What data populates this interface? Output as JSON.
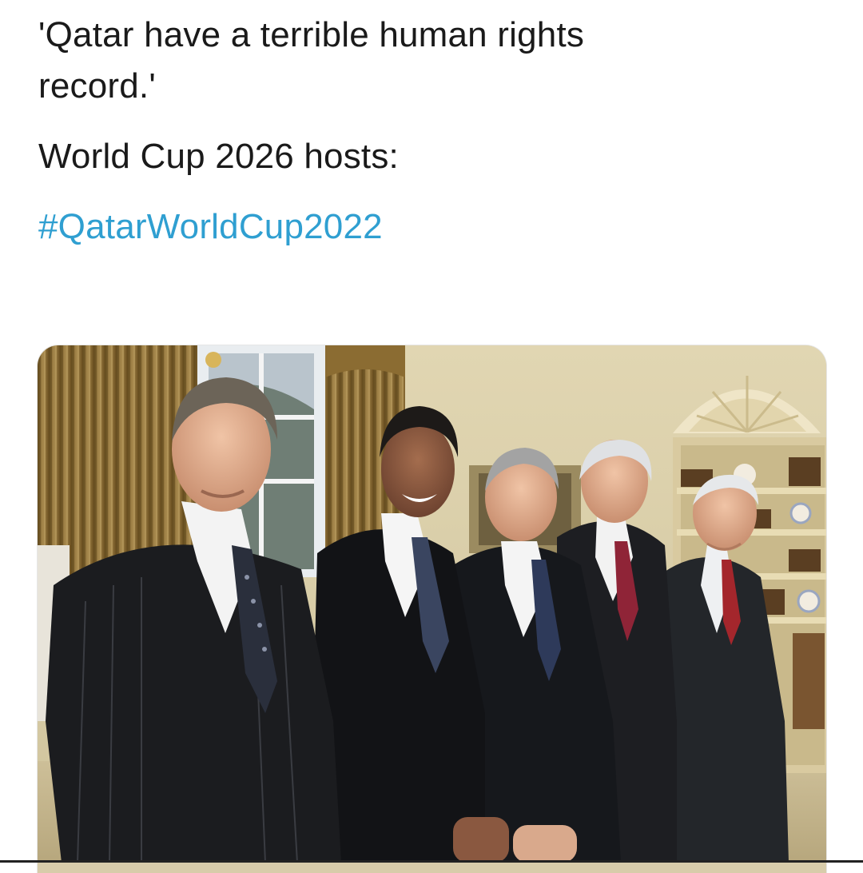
{
  "tweet": {
    "lines": [
      "'Qatar have a terrible human rights",
      "record.'",
      "World Cup 2026 hosts:"
    ],
    "hashtag": "#QatarWorldCup2022"
  },
  "media": {
    "kind": "photo",
    "people_count": 5
  },
  "colors": {
    "hashtag": "#2f9fd1",
    "text": "#1a1a1a",
    "background": "#ffffff"
  }
}
